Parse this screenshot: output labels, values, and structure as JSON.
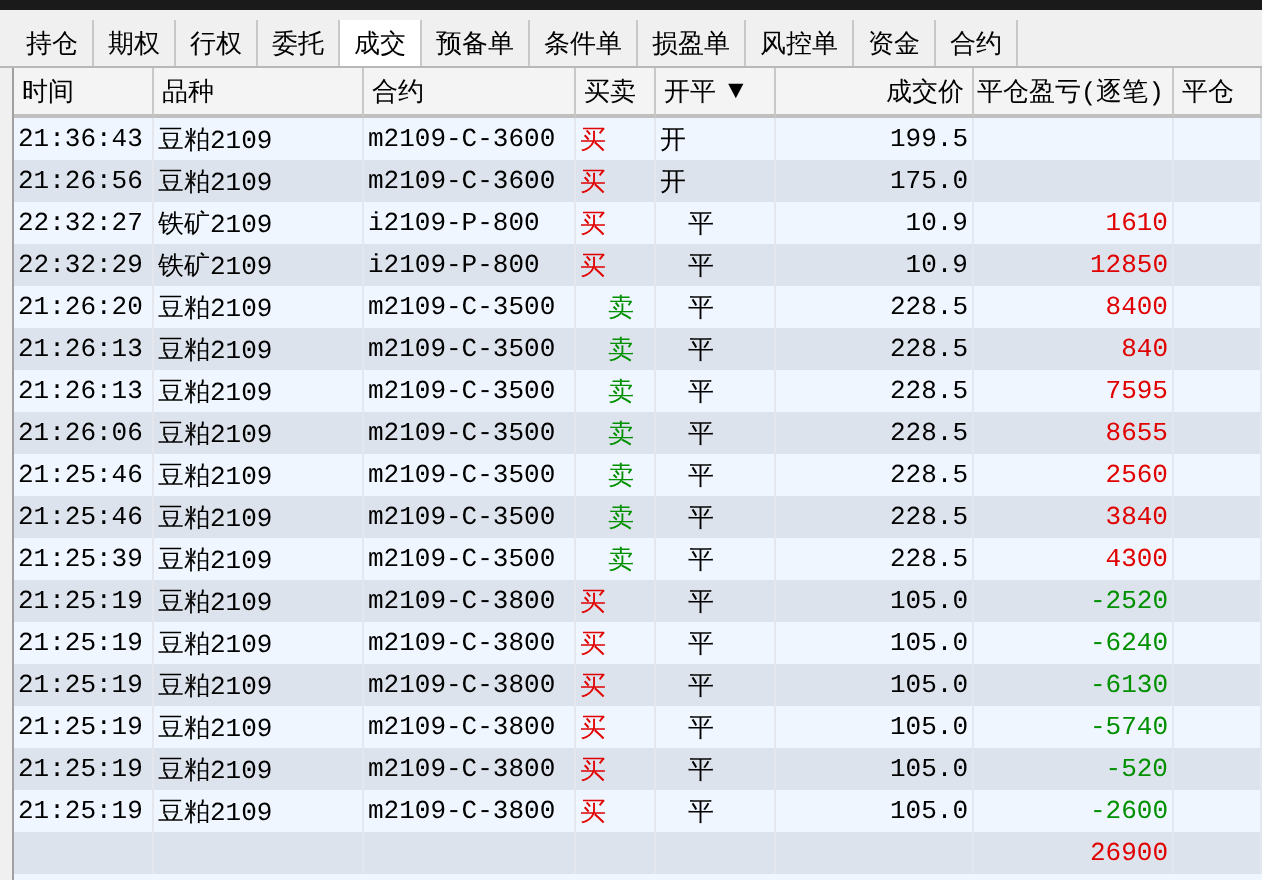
{
  "tabs": [
    {
      "label": "持仓",
      "selected": false
    },
    {
      "label": "期权",
      "selected": false
    },
    {
      "label": "行权",
      "selected": false
    },
    {
      "label": "委托",
      "selected": false
    },
    {
      "label": "成交",
      "selected": true
    },
    {
      "label": "预备单",
      "selected": false
    },
    {
      "label": "条件单",
      "selected": false
    },
    {
      "label": "损盈单",
      "selected": false
    },
    {
      "label": "风控单",
      "selected": false
    },
    {
      "label": "资金",
      "selected": false
    },
    {
      "label": "合约",
      "selected": false
    }
  ],
  "table": {
    "columns": [
      {
        "label": "时间"
      },
      {
        "label": "品种"
      },
      {
        "label": "合约"
      },
      {
        "label": "买卖"
      },
      {
        "label": "开平",
        "sort_indicator": "▼"
      },
      {
        "label": "成交价"
      },
      {
        "label": "平仓盈亏(逐笔)"
      },
      {
        "label": "平仓"
      }
    ],
    "rows": [
      {
        "time": "21:36:43",
        "product": "豆粕2109",
        "contract": "m2109-C-3600",
        "side": {
          "text": "买",
          "kind": "buy"
        },
        "offset": {
          "text": "开",
          "kind": "open"
        },
        "price": "199.5"
      },
      {
        "time": "21:26:56",
        "product": "豆粕2109",
        "contract": "m2109-C-3600",
        "side": {
          "text": "买",
          "kind": "buy"
        },
        "offset": {
          "text": "开",
          "kind": "open"
        },
        "price": "175.0"
      },
      {
        "time": "22:32:27",
        "product": "铁矿2109",
        "contract": "i2109-P-800",
        "side": {
          "text": "买",
          "kind": "buy"
        },
        "offset": {
          "text": "平",
          "kind": "close"
        },
        "price": "10.9",
        "pnl": {
          "text": "1610",
          "kind": "gain"
        }
      },
      {
        "time": "22:32:29",
        "product": "铁矿2109",
        "contract": "i2109-P-800",
        "side": {
          "text": "买",
          "kind": "buy"
        },
        "offset": {
          "text": "平",
          "kind": "close"
        },
        "price": "10.9",
        "pnl": {
          "text": "12850",
          "kind": "gain"
        }
      },
      {
        "time": "21:26:20",
        "product": "豆粕2109",
        "contract": "m2109-C-3500",
        "side": {
          "text": "卖",
          "kind": "sell"
        },
        "offset": {
          "text": "平",
          "kind": "close"
        },
        "price": "228.5",
        "pnl": {
          "text": "8400",
          "kind": "gain"
        }
      },
      {
        "time": "21:26:13",
        "product": "豆粕2109",
        "contract": "m2109-C-3500",
        "side": {
          "text": "卖",
          "kind": "sell"
        },
        "offset": {
          "text": "平",
          "kind": "close"
        },
        "price": "228.5",
        "pnl": {
          "text": "840",
          "kind": "gain"
        }
      },
      {
        "time": "21:26:13",
        "product": "豆粕2109",
        "contract": "m2109-C-3500",
        "side": {
          "text": "卖",
          "kind": "sell"
        },
        "offset": {
          "text": "平",
          "kind": "close"
        },
        "price": "228.5",
        "pnl": {
          "text": "7595",
          "kind": "gain"
        }
      },
      {
        "time": "21:26:06",
        "product": "豆粕2109",
        "contract": "m2109-C-3500",
        "side": {
          "text": "卖",
          "kind": "sell"
        },
        "offset": {
          "text": "平",
          "kind": "close"
        },
        "price": "228.5",
        "pnl": {
          "text": "8655",
          "kind": "gain"
        }
      },
      {
        "time": "21:25:46",
        "product": "豆粕2109",
        "contract": "m2109-C-3500",
        "side": {
          "text": "卖",
          "kind": "sell"
        },
        "offset": {
          "text": "平",
          "kind": "close"
        },
        "price": "228.5",
        "pnl": {
          "text": "2560",
          "kind": "gain"
        }
      },
      {
        "time": "21:25:46",
        "product": "豆粕2109",
        "contract": "m2109-C-3500",
        "side": {
          "text": "卖",
          "kind": "sell"
        },
        "offset": {
          "text": "平",
          "kind": "close"
        },
        "price": "228.5",
        "pnl": {
          "text": "3840",
          "kind": "gain"
        }
      },
      {
        "time": "21:25:39",
        "product": "豆粕2109",
        "contract": "m2109-C-3500",
        "side": {
          "text": "卖",
          "kind": "sell"
        },
        "offset": {
          "text": "平",
          "kind": "close"
        },
        "price": "228.5",
        "pnl": {
          "text": "4300",
          "kind": "gain"
        }
      },
      {
        "time": "21:25:19",
        "product": "豆粕2109",
        "contract": "m2109-C-3800",
        "side": {
          "text": "买",
          "kind": "buy"
        },
        "offset": {
          "text": "平",
          "kind": "close"
        },
        "price": "105.0",
        "pnl": {
          "text": "-2520",
          "kind": "loss"
        }
      },
      {
        "time": "21:25:19",
        "product": "豆粕2109",
        "contract": "m2109-C-3800",
        "side": {
          "text": "买",
          "kind": "buy"
        },
        "offset": {
          "text": "平",
          "kind": "close"
        },
        "price": "105.0",
        "pnl": {
          "text": "-6240",
          "kind": "loss"
        }
      },
      {
        "time": "21:25:19",
        "product": "豆粕2109",
        "contract": "m2109-C-3800",
        "side": {
          "text": "买",
          "kind": "buy"
        },
        "offset": {
          "text": "平",
          "kind": "close"
        },
        "price": "105.0",
        "pnl": {
          "text": "-6130",
          "kind": "loss"
        }
      },
      {
        "time": "21:25:19",
        "product": "豆粕2109",
        "contract": "m2109-C-3800",
        "side": {
          "text": "买",
          "kind": "buy"
        },
        "offset": {
          "text": "平",
          "kind": "close"
        },
        "price": "105.0",
        "pnl": {
          "text": "-5740",
          "kind": "loss"
        }
      },
      {
        "time": "21:25:19",
        "product": "豆粕2109",
        "contract": "m2109-C-3800",
        "side": {
          "text": "买",
          "kind": "buy"
        },
        "offset": {
          "text": "平",
          "kind": "close"
        },
        "price": "105.0",
        "pnl": {
          "text": "-520",
          "kind": "loss"
        }
      },
      {
        "time": "21:25:19",
        "product": "豆粕2109",
        "contract": "m2109-C-3800",
        "side": {
          "text": "买",
          "kind": "buy"
        },
        "offset": {
          "text": "平",
          "kind": "close"
        },
        "price": "105.0",
        "pnl": {
          "text": "-2600",
          "kind": "loss"
        }
      }
    ],
    "total": {
      "pnl": {
        "text": "26900",
        "kind": "gain"
      }
    }
  }
}
